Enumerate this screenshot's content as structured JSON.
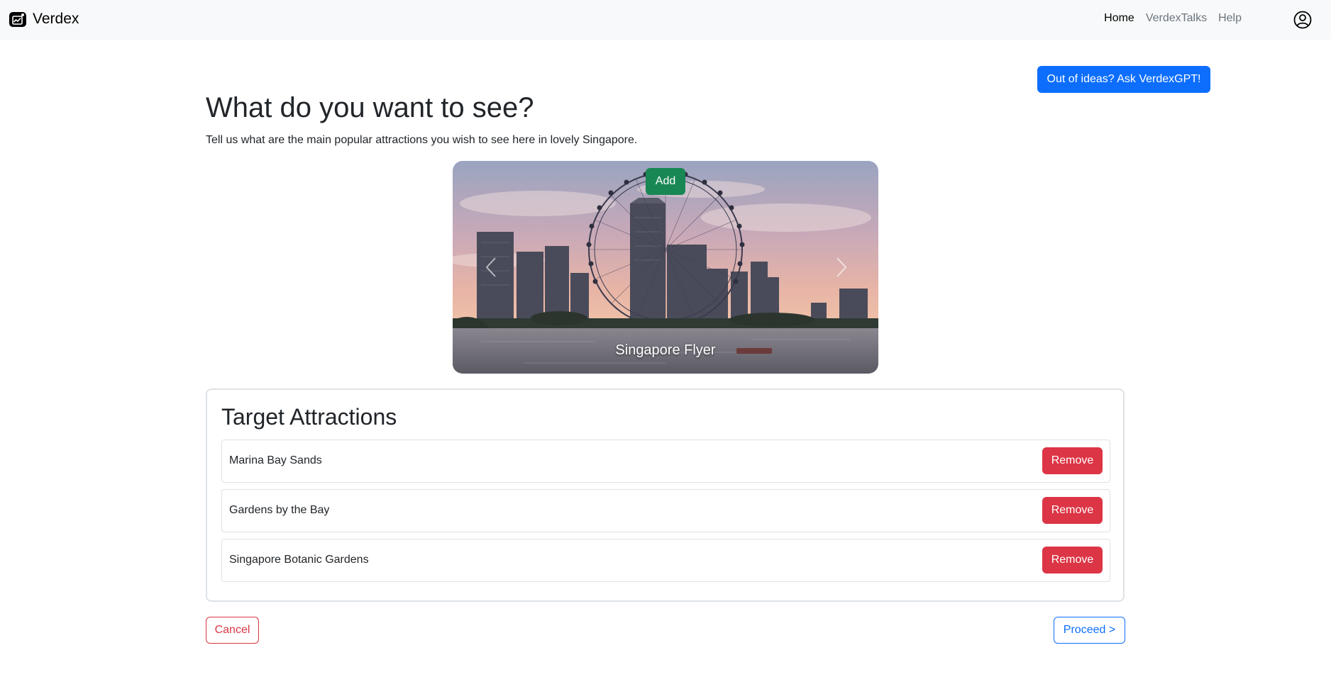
{
  "navbar": {
    "brand": "Verdex",
    "links": [
      "Home",
      "VerdexTalks",
      "Help"
    ],
    "active_link": "Home",
    "icons": {
      "brand": "wallet-chart-icon",
      "account": "person-circle-icon"
    }
  },
  "gpt_button_label": "Out of ideas? Ask VerdexGPT!",
  "page": {
    "title": "What do you want to see?",
    "subtitle": "Tell us what are the main popular attractions you wish to see here in lovely Singapore."
  },
  "carousel": {
    "add_label": "Add",
    "caption": "Singapore Flyer",
    "icons": {
      "prev": "chevron-left-icon",
      "next": "chevron-right-icon"
    }
  },
  "target": {
    "title": "Target Attractions",
    "remove_label": "Remove",
    "items": [
      "Marina Bay Sands",
      "Gardens by the Bay",
      "Singapore Botanic Gardens"
    ]
  },
  "actions": {
    "cancel_label": "Cancel",
    "proceed_label": "Proceed >"
  },
  "colors": {
    "primary": "#0d6efd",
    "success": "#198754",
    "danger": "#dc3545",
    "navbar_bg": "#f8f9fa"
  }
}
